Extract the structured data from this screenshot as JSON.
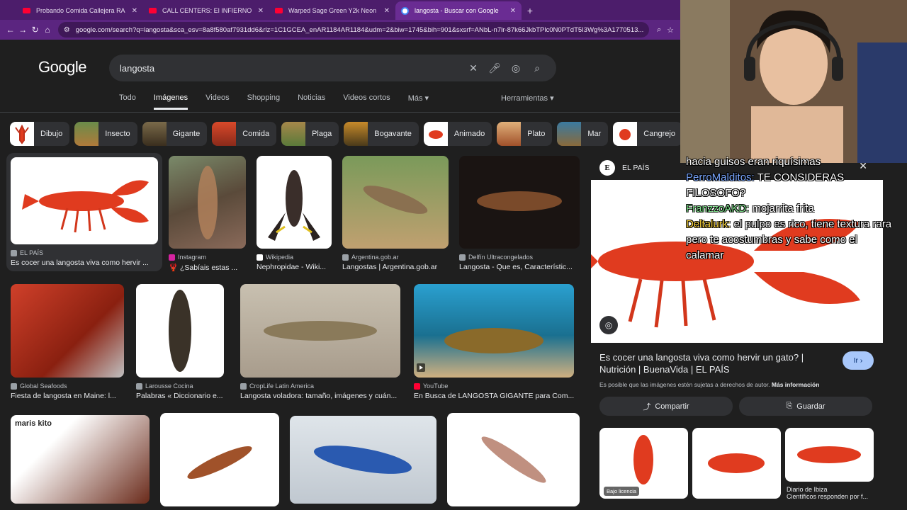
{
  "browser": {
    "tabs": [
      {
        "title": "Probando Comida Callejera RA",
        "icon": "youtube-icon"
      },
      {
        "title": "CALL CENTERS: El INFIERNO al",
        "icon": "youtube-icon"
      },
      {
        "title": "Warped Sage Green Y2k Neon",
        "icon": "youtube-icon"
      },
      {
        "title": "langosta - Buscar con Google",
        "icon": "google-icon"
      }
    ],
    "url": "google.com/search?q=langosta&sca_esv=8a8f580af7931dd6&rlz=1C1GCEA_enAR1184AR1184&udm=2&biw=1745&bih=901&sxsrf=ANbL-n7lr-87k66JkbTPlc0N0PTdT5I3Wg%3A1770513..."
  },
  "google": {
    "logo": "Google",
    "query": "langosta",
    "tabs": [
      "Todo",
      "Imágenes",
      "Videos",
      "Shopping",
      "Noticias",
      "Videos cortos",
      "Más ▾"
    ],
    "active_tab": "Imágenes",
    "tools": "Herramientas ▾",
    "chips": [
      "Dibujo",
      "Insecto",
      "Gigante",
      "Comida",
      "Plaga",
      "Bogavante",
      "Animado",
      "Plato",
      "Mar",
      "Cangrejo"
    ]
  },
  "results": [
    {
      "source": "EL PAÍS",
      "title": "Es cocer una langosta viva como hervir ..."
    },
    {
      "source": "Instagram",
      "title": "🦞 ¿Sabíais estas ..."
    },
    {
      "source": "Wikipedia",
      "title": "Nephropidae - Wiki..."
    },
    {
      "source": "Argentina.gob.ar",
      "title": "Langostas | Argentina.gob.ar"
    },
    {
      "source": "Delfín Ultracongelados",
      "title": "Langosta - Que es, Característic..."
    },
    {
      "source": "Global Seafoods",
      "title": "Fiesta de langosta en Maine: l..."
    },
    {
      "source": "Larousse Cocina",
      "title": "Palabras « Diccionario e..."
    },
    {
      "source": "CropLife Latin America",
      "title": "Langosta voladora: tamaño, imágenes y cuán..."
    },
    {
      "source": "YouTube",
      "title": "En Busca de LANGOSTA GIGANTE para Com..."
    }
  ],
  "row3_logo_text": "maris kito",
  "panel": {
    "site": "EL PAÍS",
    "site_initial": "E",
    "title": "Es cocer una langosta viva como hervir un gato? | Nutrición | BuenaVida | EL PAÍS",
    "go_button": "Ir ›",
    "copyright": "Es posible que las imágenes estén sujetas a derechos de autor.",
    "more_info": "Más información",
    "share": "Compartir",
    "save": "Guardar",
    "license_label": "Bajo licencia",
    "related_source": "Diario de Ibiza",
    "related_title": "Científicos responden por f..."
  },
  "chat": {
    "line0": "hacia guisos eran riquísimas",
    "u1": "PerroMalditos:",
    "m1": "TE CONSIDERAS FILOSOFO?",
    "u2": "FranzzoAKD:",
    "m2": "mojarrita frita",
    "u3": "Deltalurk:",
    "m3": "el pulpo es rico, tiene textura rara pero te acostumbras y sabe como el calamar"
  }
}
